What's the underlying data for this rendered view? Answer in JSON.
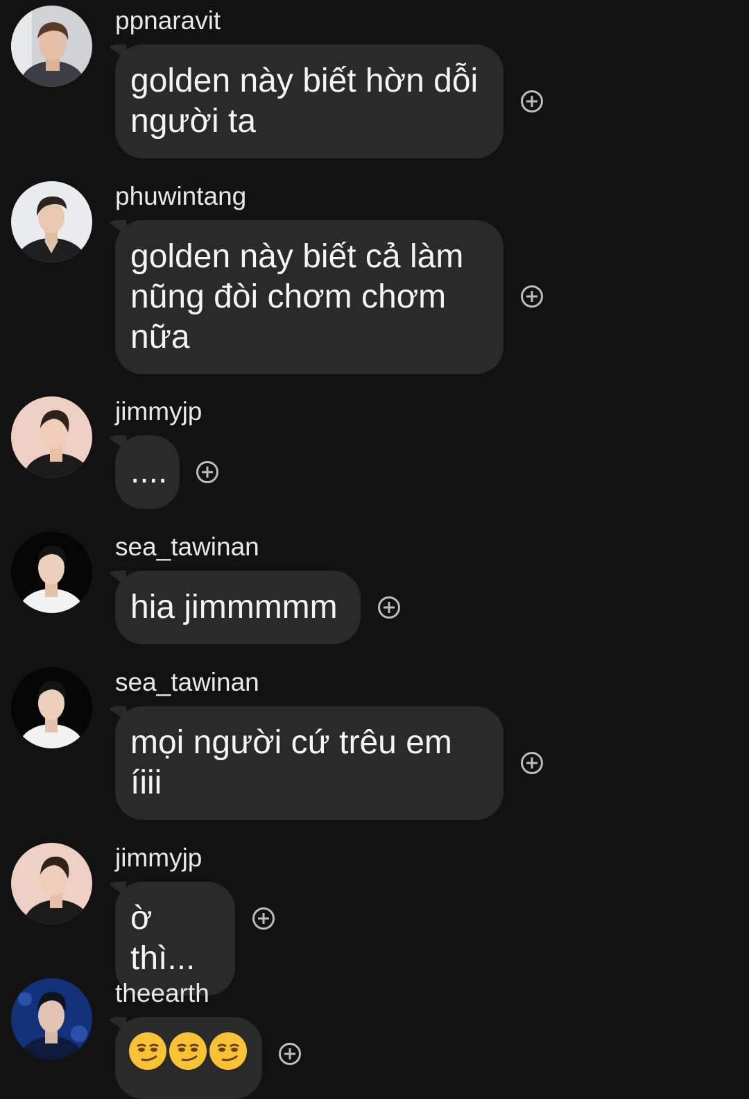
{
  "messages": [
    {
      "username": "ppnaravit",
      "text": "golden này biết hờn dỗi người ta",
      "avatar": "avatar-ppnaravit"
    },
    {
      "username": "phuwintang",
      "text": "golden này biết cả làm nũng đòi chơm chơm nữa",
      "avatar": "avatar-phuwintang"
    },
    {
      "username": "jimmyjp",
      "text": "....",
      "avatar": "avatar-jimmyjp"
    },
    {
      "username": "sea_tawinan",
      "text": "hia jimmmmm",
      "avatar": "avatar-sea_tawinan"
    },
    {
      "username": "sea_tawinan",
      "text": "mọi người cứ trêu em íiii",
      "avatar": "avatar-sea_tawinan"
    },
    {
      "username": "jimmyjp",
      "text": "ờ thì...",
      "avatar": "avatar-jimmyjp"
    },
    {
      "username": "theearth",
      "text": "",
      "emoji": [
        "smirking-face",
        "smirking-face",
        "smirking-face"
      ],
      "avatar": "avatar-theearth"
    }
  ],
  "icons": {
    "react": "add-reaction-icon"
  },
  "colors": {
    "background": "#121212",
    "bubble": "#2a2a2a",
    "text": "#f4f4f4",
    "emoji": "#f7c234"
  }
}
